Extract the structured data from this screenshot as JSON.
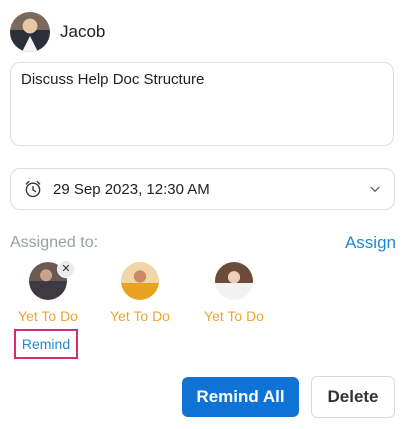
{
  "header": {
    "user_name": "Jacob"
  },
  "task": {
    "text": "Discuss Help Doc Structure"
  },
  "date_field": {
    "value": "29 Sep 2023, 12:30 AM"
  },
  "assigned": {
    "label": "Assigned to:",
    "assign_link": "Assign",
    "assignees": [
      {
        "status": "Yet To Do"
      },
      {
        "status": "Yet To Do"
      },
      {
        "status": "Yet To Do"
      }
    ],
    "remind_label": "Remind"
  },
  "actions": {
    "remind_all": "Remind All",
    "delete": "Delete"
  },
  "colors": {
    "accent": "#0f73d6",
    "link": "#1e8ad6",
    "status": "#f0a52e",
    "highlight": "#d12e74"
  }
}
